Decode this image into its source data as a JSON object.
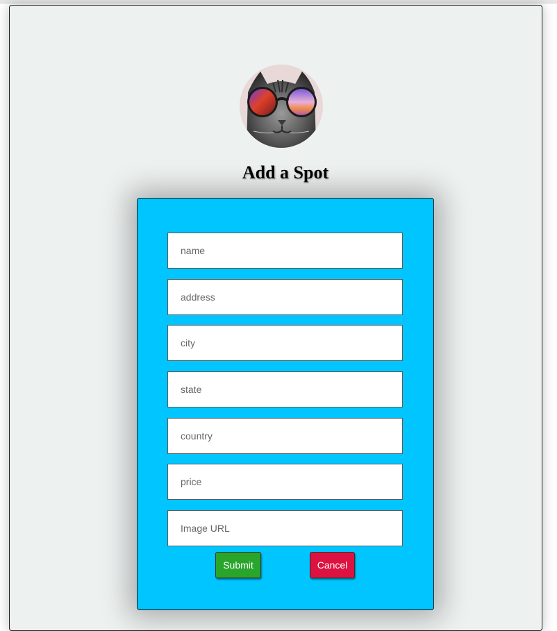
{
  "page": {
    "title": "Add a Spot"
  },
  "avatar": {
    "icon": "cat-with-sunglasses-avatar"
  },
  "form": {
    "fields": [
      {
        "key": "name",
        "placeholder": "name",
        "value": ""
      },
      {
        "key": "address",
        "placeholder": "address",
        "value": ""
      },
      {
        "key": "city",
        "placeholder": "city",
        "value": ""
      },
      {
        "key": "state",
        "placeholder": "state",
        "value": ""
      },
      {
        "key": "country",
        "placeholder": "country",
        "value": ""
      },
      {
        "key": "price",
        "placeholder": "price",
        "value": ""
      },
      {
        "key": "image_url",
        "placeholder": "Image URL",
        "value": ""
      }
    ],
    "submit_label": "Submit",
    "cancel_label": "Cancel"
  },
  "colors": {
    "page_background": "#edf1f0",
    "form_background": "#00c5ff",
    "submit": "#2aa52c",
    "cancel": "#dc1340"
  }
}
